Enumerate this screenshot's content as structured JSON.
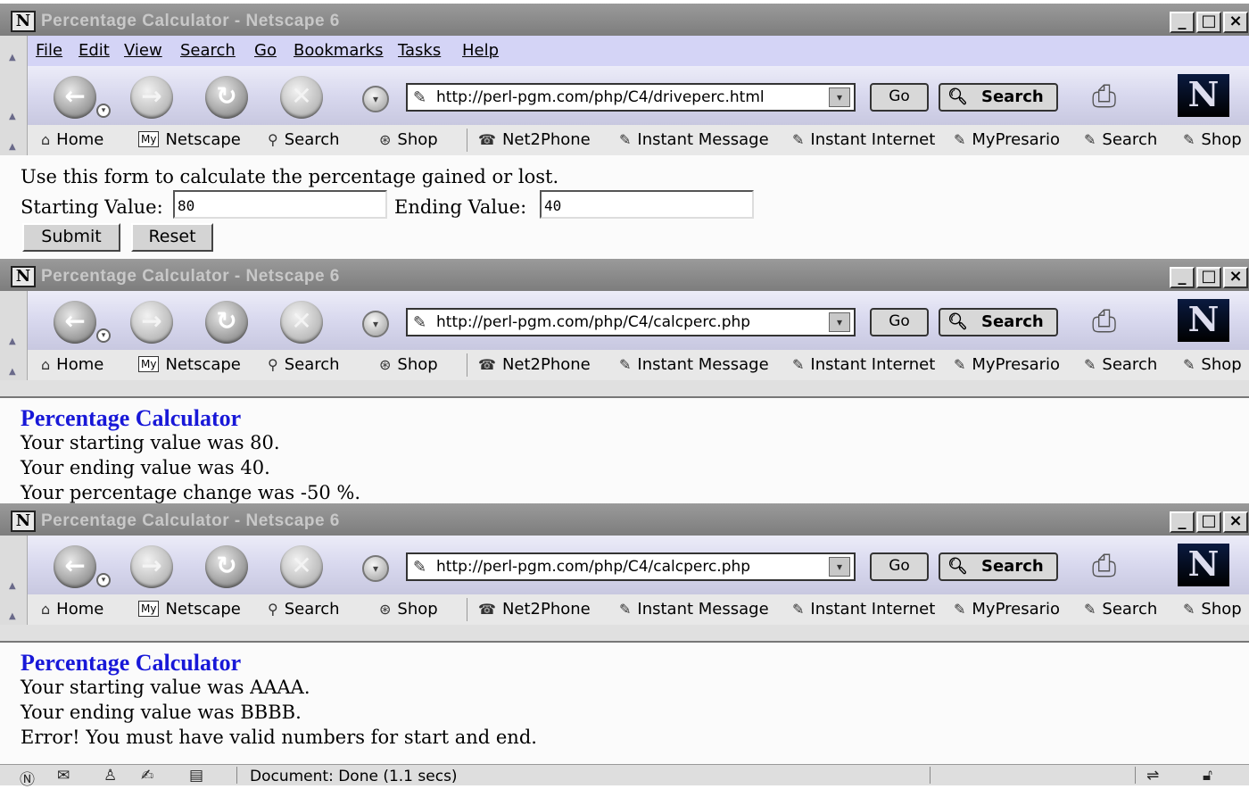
{
  "windows": [
    {
      "title": "Percentage Calculator - Netscape 6",
      "url": "http://perl-pgm.com/php/C4/driveperc.html"
    },
    {
      "title": "Percentage Calculator - Netscape 6",
      "url": "http://perl-pgm.com/php/C4/calcperc.php"
    },
    {
      "title": "Percentage Calculator - Netscape 6",
      "url": "http://perl-pgm.com/php/C4/calcperc.php"
    }
  ],
  "menu": [
    "File",
    "Edit",
    "View",
    "Search",
    "Go",
    "Bookmarks",
    "Tasks",
    "Help"
  ],
  "nav": {
    "go_label": "Go",
    "search_label": "Search",
    "logo_letter": "N",
    "window_buttons": [
      "_",
      "□",
      "×"
    ]
  },
  "personal_toolbar": [
    "Home",
    "Netscape",
    "Search",
    "Shop",
    "Net2Phone",
    "Instant Message",
    "Instant Internet",
    "MyPresario",
    "Search",
    "Shop"
  ],
  "personal_toolbar_my_badge": "My",
  "form_page": {
    "intro": "Use this form to calculate the percentage gained or lost.",
    "start_label": "Starting Value:",
    "start_value": "80",
    "end_label": "Ending Value:",
    "end_value": "40",
    "submit_label": "Submit",
    "reset_label": "Reset"
  },
  "result_page_1": {
    "heading": "Percentage Calculator",
    "lines": [
      "Your starting value was 80.",
      "Your ending value was 40.",
      "Your percentage change was -50 %."
    ]
  },
  "result_page_2": {
    "heading": "Percentage Calculator",
    "lines": [
      "Your starting value was AAAA.",
      "Your ending value was BBBB.",
      "Error! You must have valid numbers for start and end."
    ]
  },
  "status": {
    "text": "Document: Done (1.1 secs)"
  }
}
